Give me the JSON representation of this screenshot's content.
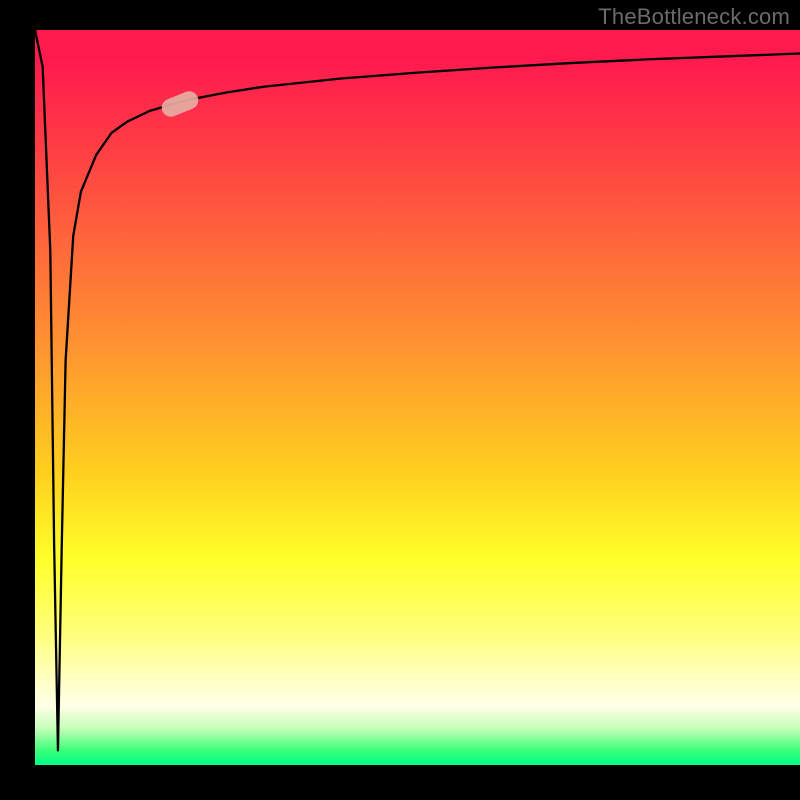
{
  "watermark": "TheBottleneck.com",
  "colors": {
    "background": "#000000",
    "gradient_top": "#ff1a4e",
    "gradient_mid": "#ffff2a",
    "gradient_bottom": "#00ff88",
    "curve": "#000000",
    "marker": "#e5aca3",
    "watermark_text": "#6b6b6b"
  },
  "chart_data": {
    "type": "line",
    "title": "",
    "xlabel": "",
    "ylabel": "",
    "xlim": [
      0,
      100
    ],
    "ylim": [
      0,
      100
    ],
    "grid": false,
    "legend": false,
    "description": "Single curve on a vertical color gradient (red at top through orange/yellow to green at bottom). The curve briefly dips from the top to the bottom near x≈3, then rises steeply and asymptotically approaches the top edge as x increases.",
    "series": [
      {
        "name": "curve",
        "x": [
          0,
          1,
          2,
          2.5,
          3,
          3.5,
          4,
          5,
          6,
          8,
          10,
          12,
          15,
          20,
          25,
          30,
          40,
          50,
          60,
          70,
          80,
          90,
          100
        ],
        "y": [
          100,
          95,
          70,
          30,
          2,
          30,
          55,
          72,
          78,
          83,
          86,
          87.5,
          89,
          90.5,
          91.5,
          92.3,
          93.4,
          94.2,
          94.9,
          95.5,
          96,
          96.4,
          96.8
        ]
      }
    ],
    "annotations": [
      {
        "type": "marker",
        "x": 19,
        "y": 90,
        "shape": "rounded-capsule",
        "rotation_deg": -22
      }
    ]
  }
}
